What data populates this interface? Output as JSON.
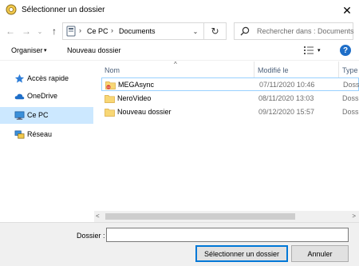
{
  "window": {
    "title": "Sélectionner un dossier",
    "close_glyph": "✕"
  },
  "nav": {
    "back": "←",
    "forward": "→",
    "recent": "⌄",
    "up": "↑"
  },
  "address": {
    "segments": [
      "Ce PC",
      "Documents"
    ],
    "chevron": "›",
    "dropdown": "⌄",
    "refresh": "↻"
  },
  "search": {
    "placeholder": "Rechercher dans : Documents"
  },
  "toolbar": {
    "organize": "Organiser",
    "organize_arrow": "▾",
    "new_folder": "Nouveau dossier",
    "view_arrow": "▾",
    "help": "?"
  },
  "sidebar": {
    "items": [
      {
        "label": "Accès rapide",
        "icon": "star-icon"
      },
      {
        "label": "OneDrive",
        "icon": "cloud-icon"
      },
      {
        "label": "Ce PC",
        "icon": "computer-icon",
        "selected": true
      },
      {
        "label": "Réseau",
        "icon": "network-icon"
      }
    ]
  },
  "columns": {
    "sort_arrow": "^",
    "name": "Nom",
    "modified": "Modifié le",
    "type": "Type"
  },
  "files": [
    {
      "name": "MEGAsync",
      "date": "07/11/2020 10:46",
      "type": "Dossi"
    },
    {
      "name": "NeroVideo",
      "date": "08/11/2020 13:03",
      "type": "Dossi"
    },
    {
      "name": "Nouveau dossier",
      "date": "09/12/2020 15:57",
      "type": "Dossi"
    }
  ],
  "scroll": {
    "left": "<",
    "right": ">"
  },
  "footer": {
    "folder_label": "Dossier :",
    "folder_value": "",
    "select_button": "Sélectionner un dossier",
    "cancel_button": "Annuler"
  },
  "colors": {
    "accent": "#0078d7",
    "selection": "#cce8ff",
    "folder": "#f8d775",
    "help": "#1e6ec8"
  }
}
